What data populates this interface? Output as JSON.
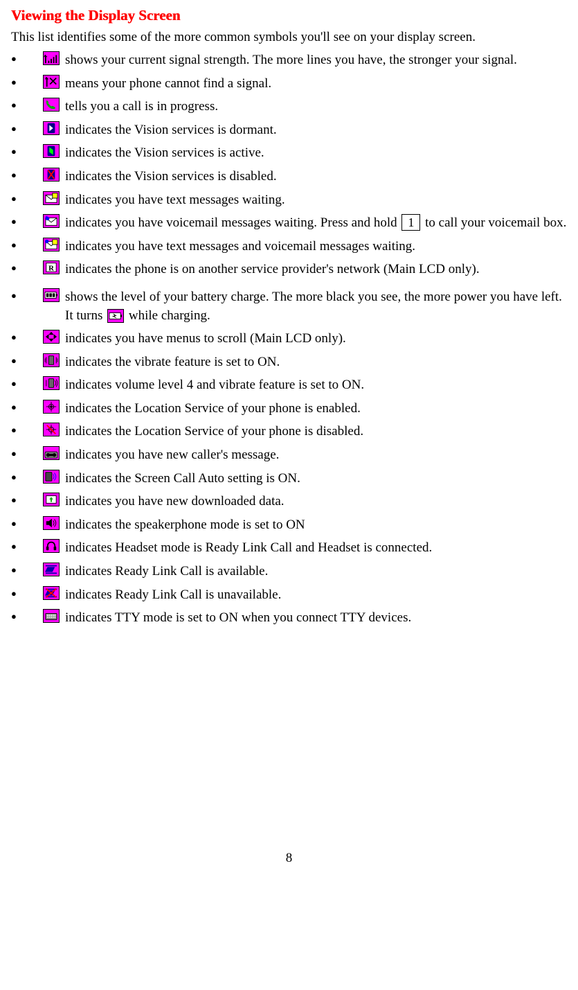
{
  "title": "Viewing the Display Screen",
  "intro": "This list identifies some of the more common symbols you'll see on your display screen.",
  "items": [
    {
      "icon": "signal-strength-icon",
      "text": " shows your current signal strength. The more lines you have, the stronger your signal."
    },
    {
      "icon": "no-signal-icon",
      "text": " means your phone cannot find a signal."
    },
    {
      "icon": "call-in-progress-icon",
      "text": " tells you a call is in progress."
    },
    {
      "icon": "vision-dormant-icon",
      "text": " indicates the Vision services is dormant."
    },
    {
      "icon": "vision-active-icon",
      "text": " indicates the Vision services is active."
    },
    {
      "icon": "vision-disabled-icon",
      "text": " indicates the Vision services is disabled."
    },
    {
      "icon": "text-message-icon",
      "text": " indicates you have text messages waiting."
    },
    {
      "icon": "voicemail-icon",
      "text_a": " indicates you have voicemail messages waiting. Press and hold ",
      "key": "1",
      "text_b": " to call your voicemail box."
    },
    {
      "icon": "text-voicemail-icon",
      "text": " indicates you have text messages and voicemail messages waiting."
    },
    {
      "icon": "roaming-icon",
      "text": " indicates the phone is on another service provider's network (Main LCD only)."
    },
    {
      "icon": "battery-icon",
      "text_a": " shows the level of your battery charge. The more black you see, the more power you have left. It turns ",
      "inline_icon": "battery-charging-icon",
      "text_b": " while charging."
    },
    {
      "icon": "scroll-menus-icon",
      "text": " indicates you have menus to scroll (Main LCD only)."
    },
    {
      "icon": "vibrate-on-icon",
      "text": " indicates the vibrate feature is set to ON."
    },
    {
      "icon": "volume-vibrate-icon",
      "text": " indicates volume level 4 and vibrate feature is set to ON."
    },
    {
      "icon": "location-enabled-icon",
      "text": " indicates the Location Service of your phone is enabled."
    },
    {
      "icon": "location-disabled-icon",
      "text": " indicates the Location Service of your phone is disabled."
    },
    {
      "icon": "new-caller-message-icon",
      "text": " indicates you have new caller's message."
    },
    {
      "icon": "screen-call-auto-icon",
      "text": " indicates the Screen Call Auto setting is ON."
    },
    {
      "icon": "new-download-icon",
      "text": " indicates you have new downloaded data."
    },
    {
      "icon": "speakerphone-icon",
      "text": " indicates the speakerphone mode is set to ON"
    },
    {
      "icon": "headset-ready-link-icon",
      "text": " indicates Headset mode is Ready Link Call and Headset is connected."
    },
    {
      "icon": "ready-link-available-icon",
      "text": " indicates Ready Link Call is available."
    },
    {
      "icon": "ready-link-unavailable-icon",
      "text": " indicates Ready Link Call is unavailable."
    },
    {
      "icon": "tty-mode-icon",
      "text": " indicates TTY mode is set to ON when you connect TTY devices."
    }
  ],
  "page_number": "8"
}
